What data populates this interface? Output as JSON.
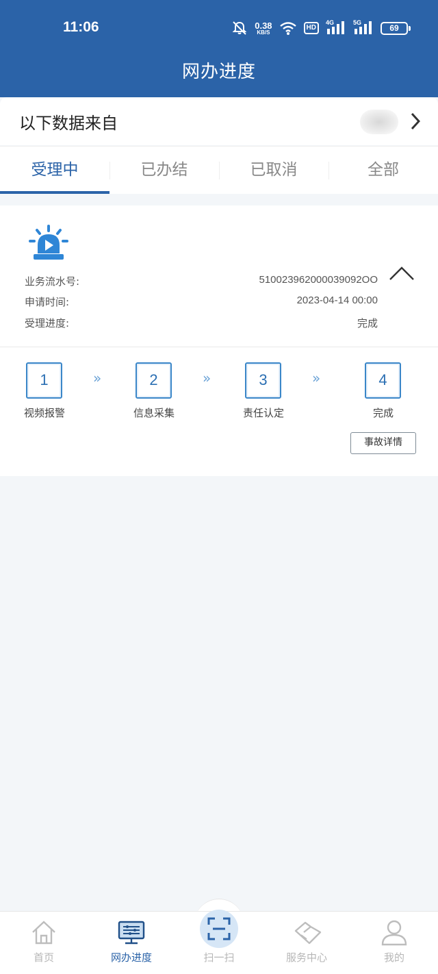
{
  "status_bar": {
    "time": "11:06",
    "net_speed_value": "0.38",
    "net_speed_unit": "KB/S",
    "hd_label": "HD",
    "signal1_label": "4G",
    "signal2_label": "5G",
    "battery": "69"
  },
  "header": {
    "title": "网办进度"
  },
  "source": {
    "label": "以下数据来自"
  },
  "tabs": [
    {
      "label": "受理中",
      "active": true
    },
    {
      "label": "已办结",
      "active": false
    },
    {
      "label": "已取消",
      "active": false
    },
    {
      "label": "全部",
      "active": false
    }
  ],
  "record": {
    "serial_label": "业务流水号:",
    "serial_value": "510023962000039092OO",
    "apply_time_label": "申请时间:",
    "apply_time_value": "2023-04-14 00:00",
    "progress_label": "受理进度:",
    "progress_value": "完成",
    "steps": [
      {
        "num": "1",
        "label": "视频报警"
      },
      {
        "num": "2",
        "label": "信息采集"
      },
      {
        "num": "3",
        "label": "责任认定"
      },
      {
        "num": "4",
        "label": "完成"
      }
    ],
    "arrow_glyph": "»",
    "detail_button": "事故详情"
  },
  "bottom_nav": [
    {
      "label": "首页",
      "icon": "home-icon"
    },
    {
      "label": "网办进度",
      "icon": "monitor-icon",
      "active": true
    },
    {
      "label": "扫一扫",
      "icon": "scan-icon"
    },
    {
      "label": "服务中心",
      "icon": "handshake-icon"
    },
    {
      "label": "我的",
      "icon": "user-icon"
    }
  ],
  "colors": {
    "primary": "#2b63a8",
    "step_border": "#3a86c8",
    "inactive": "#b6b6b6"
  }
}
